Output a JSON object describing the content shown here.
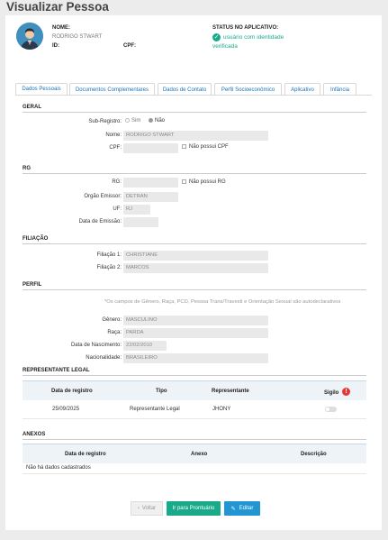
{
  "page": {
    "title": "Visualizar Pessoa"
  },
  "header": {
    "name_label": "NOME:",
    "name_value": "RODRIGO STWART",
    "id_label": "ID:",
    "cpf_label": "CPF:",
    "status_label": "STATUS NO APLICATIVO:",
    "status_value_line1": "usuário com identidade",
    "status_value_line2": "verificada"
  },
  "tabs": [
    "Dados Pessoais",
    "Documentos Complementares",
    "Dados de Contato",
    "Perfil Socioeconômico",
    "Aplicativo",
    "Infância"
  ],
  "geral": {
    "title": "GERAL",
    "subregistro_label": "Sub-Registro:",
    "sim": "Sim",
    "nao": "Não",
    "nome_label": "Nome:",
    "nome_value": "RODRIGO STWART",
    "cpf_label": "CPF:",
    "nao_possui_cpf": "Não possui CPF"
  },
  "rg": {
    "title": "RG",
    "rg_label": "RG:",
    "nao_possui_rg": "Não possui RG",
    "orgao_label": "Orgão Emissor:",
    "orgao_value": "DETRAN",
    "uf_label": "UF:",
    "uf_value": "RJ",
    "data_label": "Data de Emissão:"
  },
  "filiacao": {
    "title": "FILIAÇÃO",
    "f1_label": "Filiação 1:",
    "f1_value": "CHRISTIANE",
    "f2_label": "Filiação 2:",
    "f2_value": "MARCOS"
  },
  "perfil": {
    "title": "PERFIL",
    "note": "*Os campos de Gênero, Raça, PCD, Pessoa Trans/Travesti e Orientação Sexual são autodeclarativos",
    "genero_label": "Gênero:",
    "genero_value": "MASCULINO",
    "raca_label": "Raça:",
    "raca_value": "PARDA",
    "nasc_label": "Data de Nascimento:",
    "nasc_value": "22/02/2010",
    "nac_label": "Nacionalidade:",
    "nac_value": "BRASILEIRO"
  },
  "representante": {
    "title": "REPRESENTANTE LEGAL",
    "columns": [
      "Data de registro",
      "Tipo",
      "Representante",
      "Sigilo"
    ],
    "row": {
      "data": "25/09/2025",
      "tipo": "Representante Legal",
      "representante": "JHONY"
    }
  },
  "anexos": {
    "title": "ANEXOS",
    "columns": [
      "Data de registro",
      "Anexo",
      "Descrição"
    ],
    "empty": "Não há dados cadastrados"
  },
  "actions": {
    "voltar": "Voltar",
    "prontuario": "Ir para Prontuário",
    "editar": "Editar"
  },
  "colors": {
    "primary": "#1a73b8",
    "success": "#1aaa8a",
    "danger": "#e53935"
  }
}
